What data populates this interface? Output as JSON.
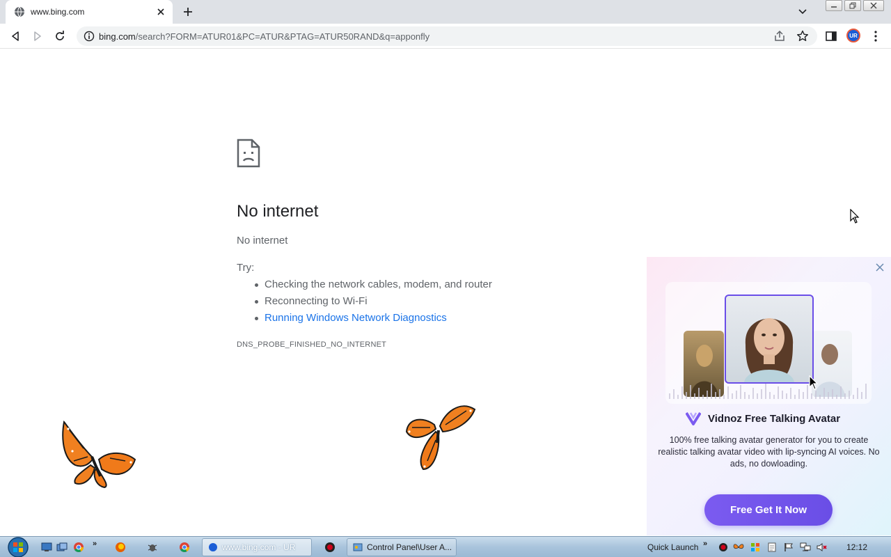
{
  "browser": {
    "tab": {
      "title": "www.bing.com",
      "favicon": "globe-icon"
    },
    "url": {
      "host": "bing.com",
      "path": "/search?FORM=ATUR01&PC=ATUR&PTAG=ATUR50RAND&q=apponfly"
    },
    "profile_initials": "UR"
  },
  "error_page": {
    "title": "No internet",
    "subtitle": "No internet",
    "try_label": "Try:",
    "suggestions": [
      "Checking the network cables, modem, and router",
      "Reconnecting to Wi-Fi",
      "Running Windows Network Diagnostics"
    ],
    "error_code": "DNS_PROBE_FINISHED_NO_INTERNET",
    "link_color": "#1a73e8"
  },
  "ad": {
    "brand": "Vidnoz Free Talking Avatar",
    "description": "100% free talking avatar generator for you to create realistic talking avatar video with lip-syncing AI voices. No ads, no dowloading.",
    "cta": "Free Get It Now",
    "accent": "#6a4ee6"
  },
  "taskbar": {
    "tasks": [
      {
        "label": "www.bing.com - UR"
      },
      {
        "label": "Control Panel\\User A..."
      }
    ],
    "quick_launch": "Quick Launch",
    "clock": "12:12"
  }
}
